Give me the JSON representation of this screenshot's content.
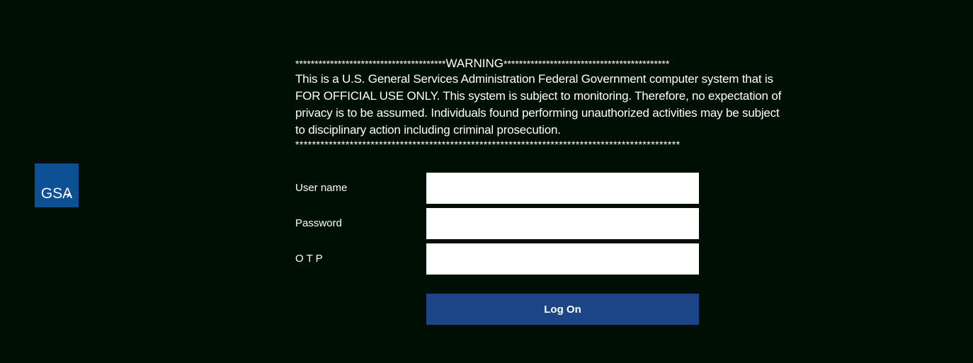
{
  "logo": {
    "text": "GSA",
    "color": "#0d5194"
  },
  "warning": {
    "top_stars_left": "***************************************",
    "title": "WARNING",
    "top_stars_right": "*******************************************",
    "body": "This is a U.S. General Services Administration Federal Government computer system that is FOR OFFICIAL USE ONLY. This system is subject to monitoring. Therefore, no expectation of privacy is to be assumed. Individuals found performing unauthorized activities may be subject to disciplinary action including criminal prosecution.",
    "bottom_stars": "********************************************************************************************"
  },
  "form": {
    "username_label": "User name",
    "username_value": "",
    "password_label": "Password",
    "password_value": "",
    "otp_label": "O T P",
    "otp_value": ""
  },
  "logon_button": {
    "label": "Log On",
    "color": "#1c4587"
  },
  "colors": {
    "background": "#000f04"
  }
}
